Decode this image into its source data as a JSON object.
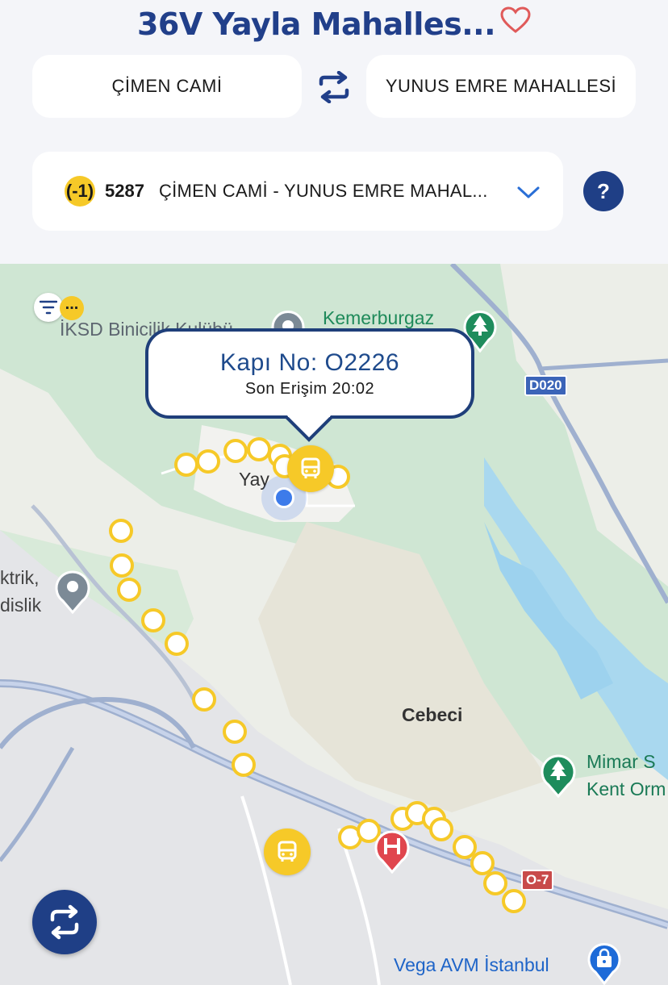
{
  "header": {
    "title": "36V Yayla Mahalles...",
    "from_stop": "ÇİMEN CAMİ",
    "to_stop": "YUNUS EMRE MAHALLESİ",
    "favorite_icon": "heart-outline-icon",
    "swap_icon": "swap-arrows-icon"
  },
  "route": {
    "direction_badge": "(-1)",
    "number": "5287",
    "name": "ÇİMEN CAMİ  -  YUNUS EMRE MAHAL...",
    "help_label": "?"
  },
  "map": {
    "popup": {
      "title": "Kapı No: O2226",
      "subtitle": "Son Erişim 20:02"
    },
    "filter_badge": "...",
    "labels": {
      "iksd": "İKSD Binicilik Kulübü",
      "kemerburgaz": "Kemerburgaz",
      "yayla": "Yay",
      "elektrik_line1": "ktrik,",
      "elektrik_line2": "dislik",
      "cebeci": "Cebeci",
      "mimar_line1": "Mimar S",
      "mimar_line2": "Kent Orm",
      "vega": "Vega AVM İstanbul",
      "road_d020": "D020",
      "road_o7": "O-7"
    }
  },
  "colors": {
    "brand_blue": "#213f8a",
    "stop_yellow": "#f6c928",
    "header_bg": "#f4f5f9"
  }
}
